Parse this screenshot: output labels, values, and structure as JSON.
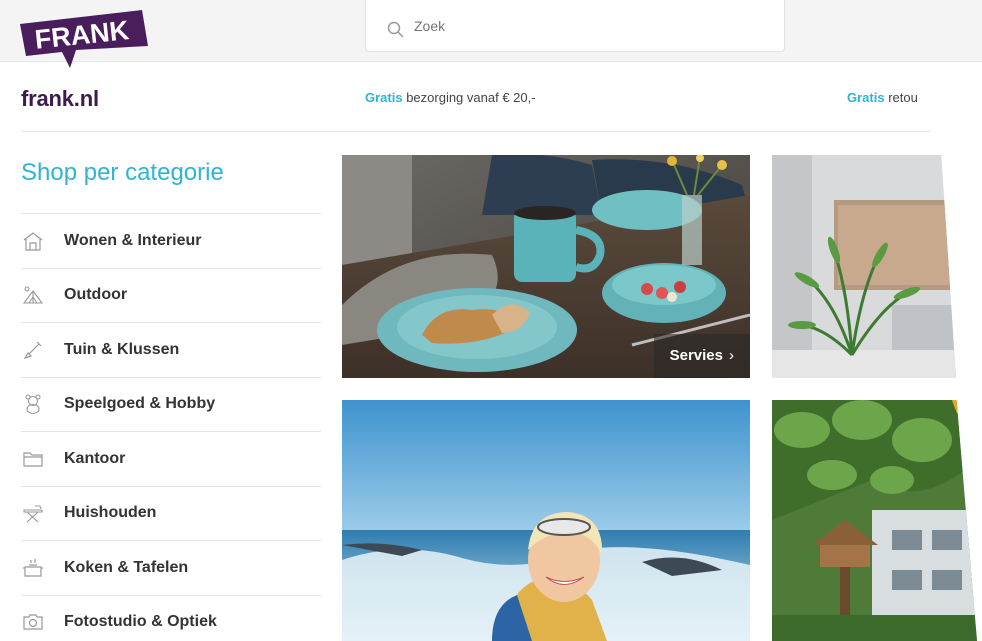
{
  "header": {
    "logo_text": "FRANK",
    "search": {
      "placeholder": "Zoek",
      "value": ""
    }
  },
  "brand": {
    "site_name": "frank.nl",
    "usps": [
      {
        "highlight": "Gratis",
        "text": " bezorging vanaf € 20,-"
      },
      {
        "highlight": "Gratis",
        "text": " retou"
      }
    ]
  },
  "sidebar": {
    "title": "Shop per categorie",
    "items": [
      {
        "label": "Wonen & Interieur",
        "icon": "house-icon"
      },
      {
        "label": "Outdoor",
        "icon": "tent-icon"
      },
      {
        "label": "Tuin & Klussen",
        "icon": "shovel-icon"
      },
      {
        "label": "Speelgoed & Hobby",
        "icon": "teddy-bear-icon"
      },
      {
        "label": "Kantoor",
        "icon": "folder-icon"
      },
      {
        "label": "Huishouden",
        "icon": "ironing-board-icon"
      },
      {
        "label": "Koken & Tafelen",
        "icon": "cooking-pot-icon"
      },
      {
        "label": "Fotostudio & Optiek",
        "icon": "camera-icon"
      }
    ]
  },
  "tiles": [
    {
      "label": "Servies",
      "chevron": "›"
    }
  ],
  "colors": {
    "brand_purple": "#3d1a4d",
    "accent_blue": "#2fb3d6"
  }
}
